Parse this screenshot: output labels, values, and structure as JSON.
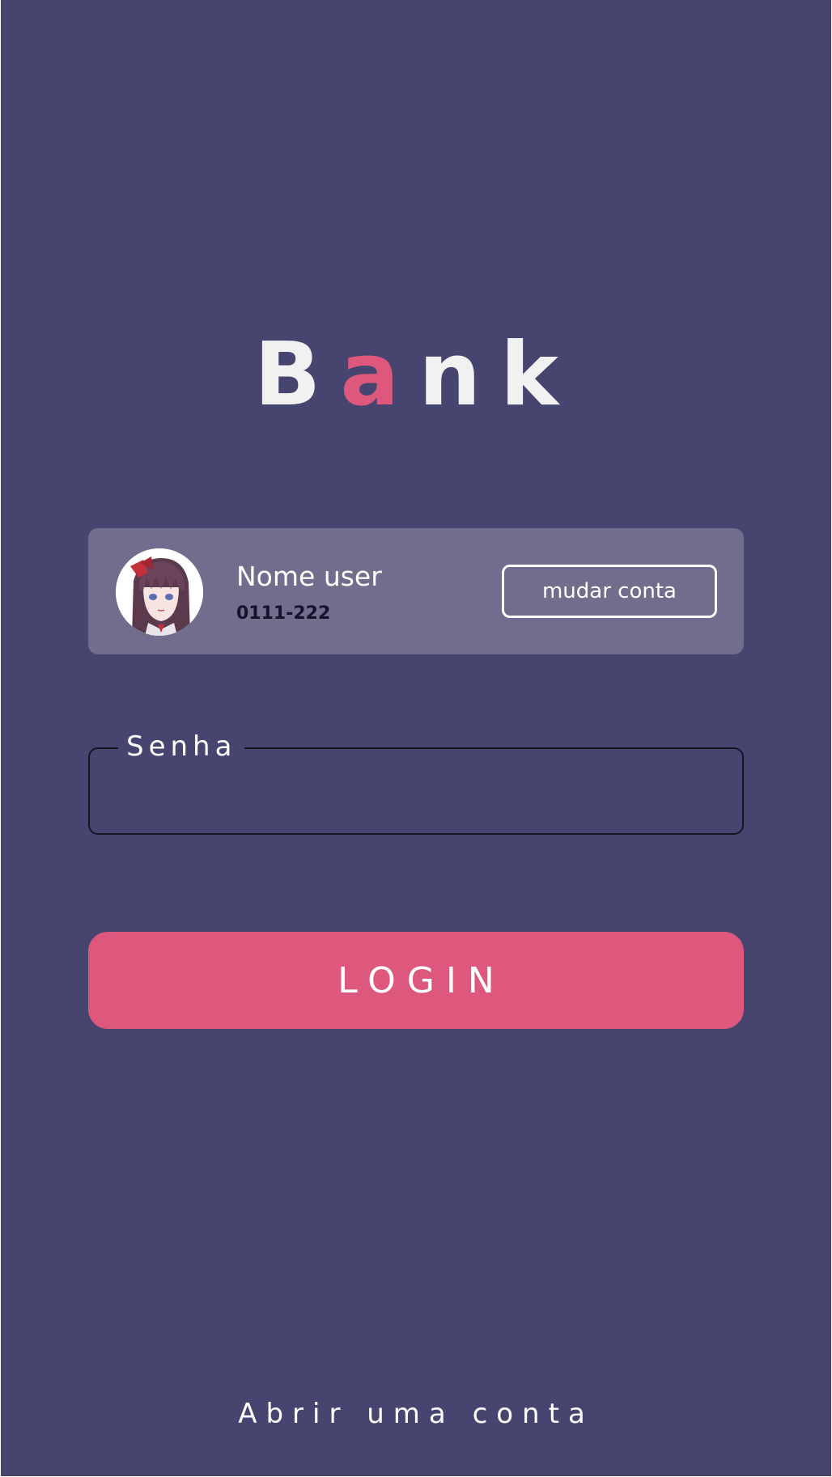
{
  "app": {
    "title_parts": [
      "B",
      "a",
      "nk"
    ]
  },
  "account": {
    "name": "Nome user",
    "number": "0111-222",
    "switch_label": "mudar conta",
    "avatar_icon": "user-avatar-icon"
  },
  "password": {
    "label": "Senha",
    "value": ""
  },
  "actions": {
    "login_label": "LOGIN",
    "open_account_label": "Abrir uma conta"
  },
  "colors": {
    "background": "#464570",
    "accent": "#de587d",
    "card": "#716d8c",
    "text": "#ffffff",
    "dark_text": "#14132a"
  }
}
